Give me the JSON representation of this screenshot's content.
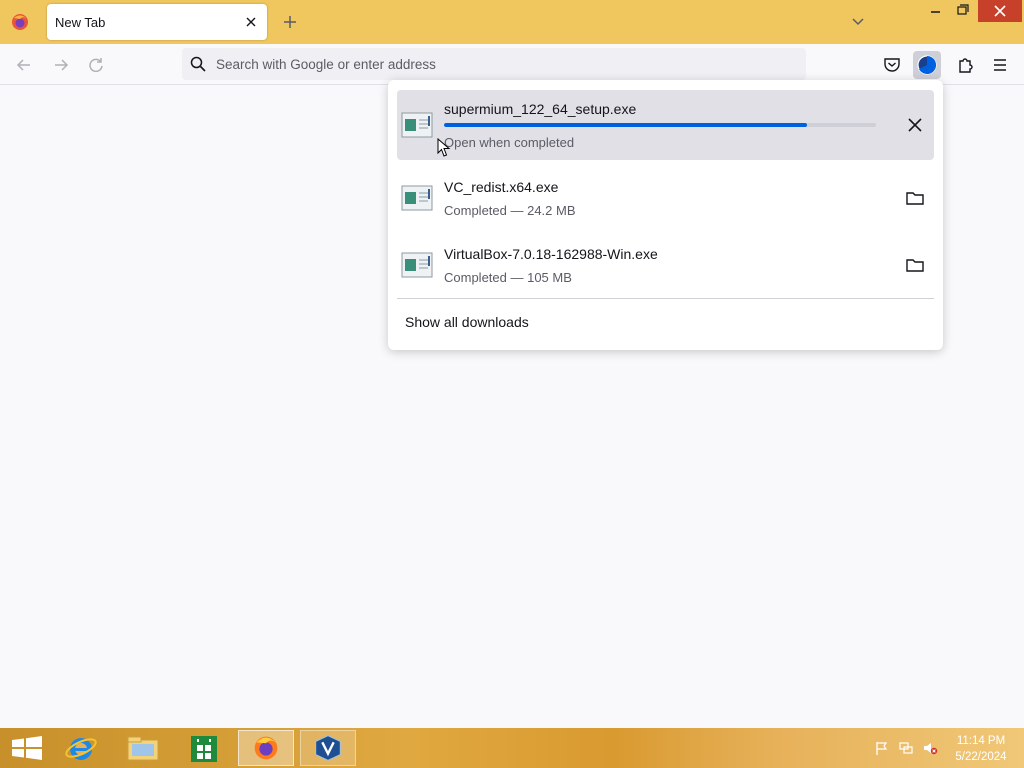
{
  "browser": {
    "tab": {
      "title": "New Tab"
    },
    "urlbar": {
      "placeholder": "Search with Google or enter address"
    }
  },
  "downloads": {
    "items": [
      {
        "name": "supermium_122_64_setup.exe",
        "status": "Open when completed",
        "progress": 0.84,
        "action": "cancel-icon"
      },
      {
        "name": "VC_redist.x64.exe",
        "status": "Completed — 24.2 MB",
        "action": "folder-icon"
      },
      {
        "name": "VirtualBox-7.0.18-162988-Win.exe",
        "status": "Completed — 105 MB",
        "action": "folder-icon"
      }
    ],
    "show_all_label": "Show all downloads"
  },
  "taskbar": {
    "pinned": [
      "start-icon",
      "internet-explorer-icon",
      "file-explorer-icon",
      "store-icon",
      "firefox-icon",
      "virtualbox-icon"
    ],
    "clock": {
      "time": "11:14 PM",
      "date": "5/22/2024"
    }
  },
  "colors": {
    "titlebar": "#f0c75e",
    "progress": "#0061e0",
    "close_button": "#c7402a"
  }
}
